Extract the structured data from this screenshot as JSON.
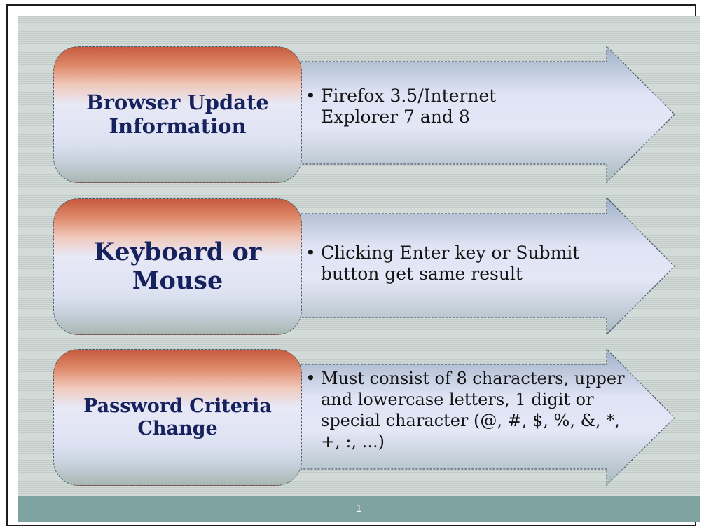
{
  "rows": [
    {
      "label": "Browser Update Information",
      "bullet": "Firefox 3.5/Internet Explorer 7 and 8"
    },
    {
      "label": "Keyboard or Mouse",
      "bullet": "Clicking Enter key or Submit button get same result"
    },
    {
      "label": "Password Criteria Change",
      "bullet": "Must consist of 8 characters, upper and lowercase letters, 1 digit or special character (@, #, $, %, &, *, +, :, ...)"
    }
  ],
  "bullet_glyph": "•",
  "footer": {
    "page_number": "1"
  },
  "colors": {
    "label_text": "#16225e",
    "footer_bar": "#7fa3a1",
    "box_top": "#c75a3e",
    "box_mid": "#e8e8f6",
    "arrow_fill": "#c2cbde"
  }
}
